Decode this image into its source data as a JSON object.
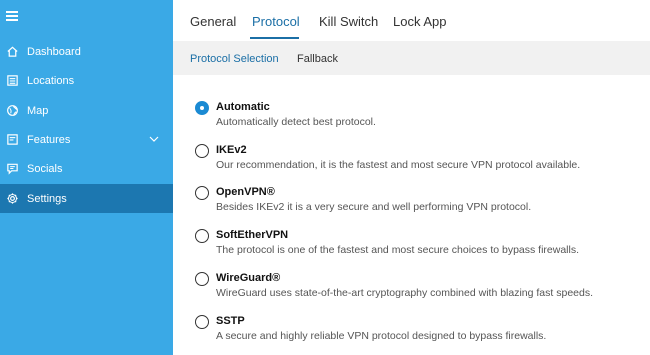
{
  "sidebar": {
    "items": [
      {
        "label": "Dashboard",
        "icon": "home-icon"
      },
      {
        "label": "Locations",
        "icon": "list-icon"
      },
      {
        "label": "Map",
        "icon": "globe-icon"
      },
      {
        "label": "Features",
        "icon": "features-icon"
      },
      {
        "label": "Socials",
        "icon": "chat-icon"
      },
      {
        "label": "Settings",
        "icon": "gear-icon",
        "active": true
      }
    ]
  },
  "top_tabs": {
    "general": "General",
    "protocol": "Protocol",
    "kill_switch": "Kill Switch",
    "lock_app": "Lock App"
  },
  "sub_tabs": {
    "protocol_selection": "Protocol Selection",
    "fallback": "Fallback"
  },
  "options": [
    {
      "title": "Automatic",
      "desc": "Automatically detect best protocol.",
      "selected": true
    },
    {
      "title": "IKEv2",
      "desc": "Our recommendation, it is the fastest and most secure VPN protocol available."
    },
    {
      "title": "OpenVPN®",
      "desc": "Besides IKEv2 it is a very secure and well performing VPN protocol."
    },
    {
      "title": "SoftEtherVPN",
      "desc": "The protocol is one of the fastest and most secure choices to bypass firewalls."
    },
    {
      "title": "WireGuard®",
      "desc": "WireGuard uses state-of-the-art cryptography combined with blazing fast speeds."
    },
    {
      "title": "SSTP",
      "desc": "A secure and highly reliable VPN protocol designed to bypass firewalls."
    }
  ],
  "colors": {
    "sidebar_bg": "#3aa9e6",
    "sidebar_active": "#1c77b0",
    "accent": "#1b6fa6",
    "radio_selected": "#1b8ad3"
  }
}
